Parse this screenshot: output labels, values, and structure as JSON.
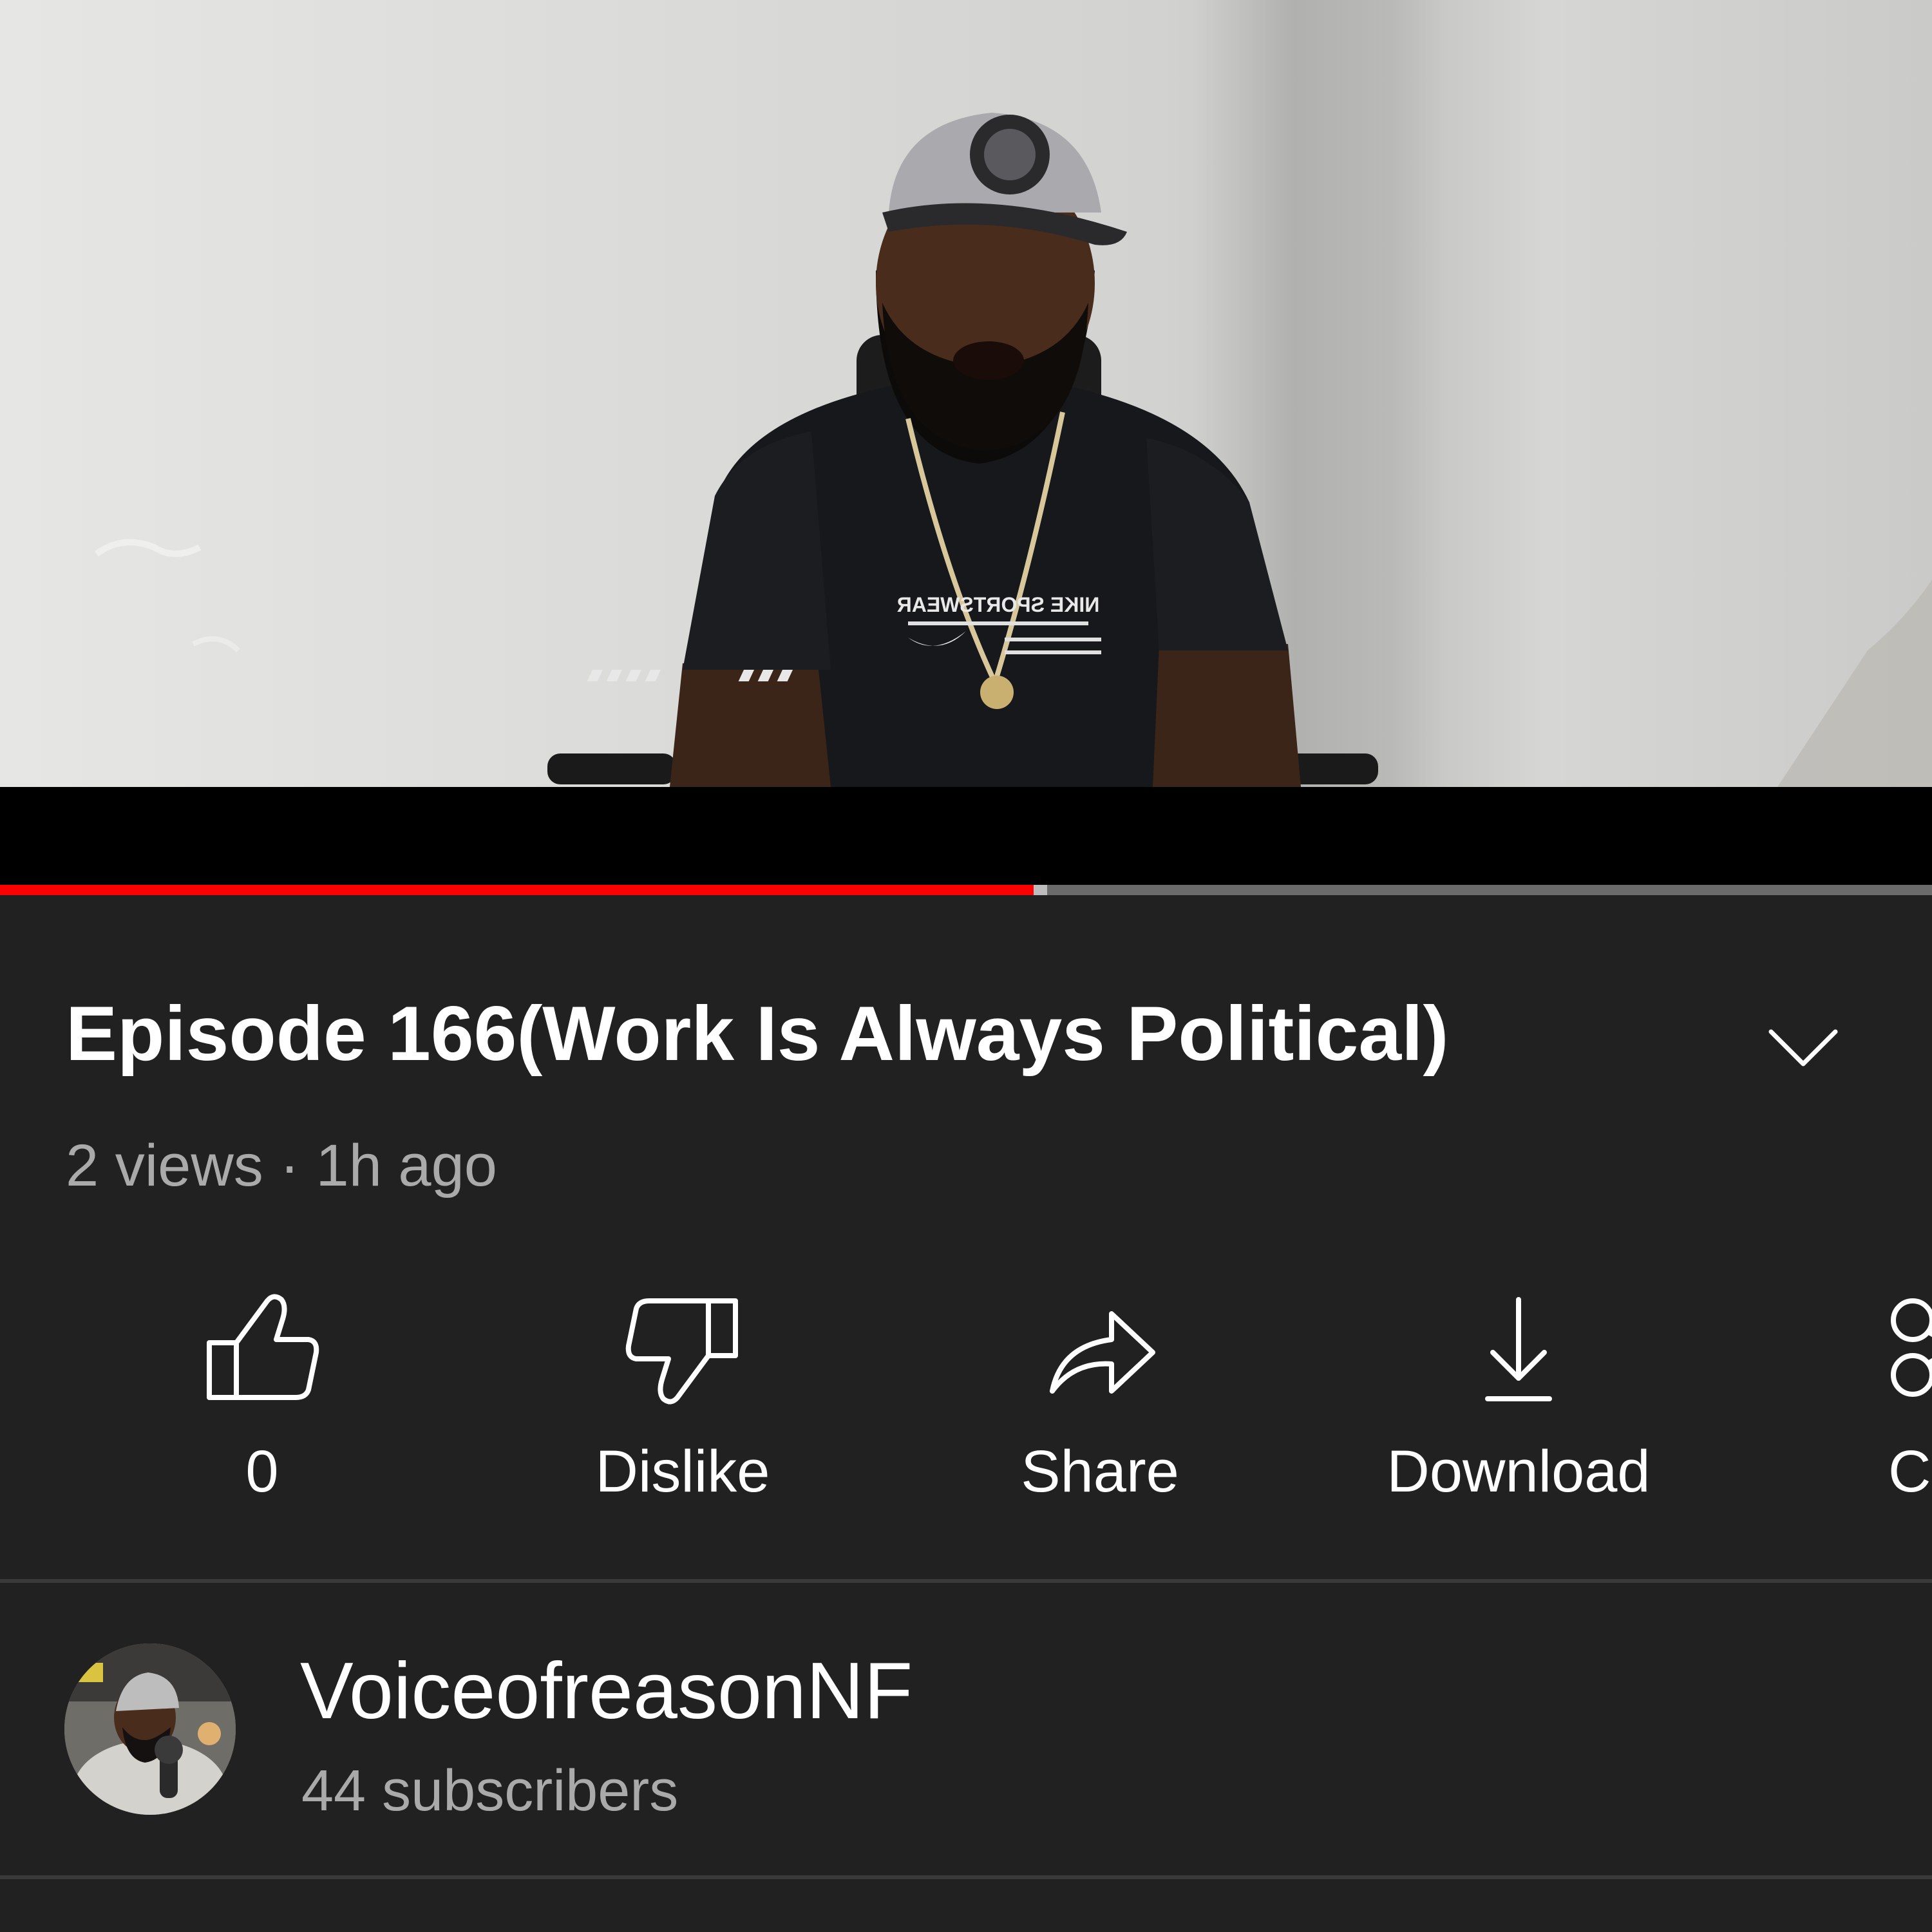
{
  "video": {
    "progress_fraction": 0.535,
    "buffered_fraction": 0.542,
    "progress_color": "#ff0000",
    "track_color": "#6b6b6b",
    "shirt_text": "NIKE SPORTSWEAR"
  },
  "title": "Episode 166(Work Is Always Political)",
  "meta": "2 views · 1h ago",
  "expand_icon": "chevron-down-icon",
  "actions": [
    {
      "name": "like",
      "icon": "thumbs-up-icon",
      "label": "0"
    },
    {
      "name": "dislike",
      "icon": "thumbs-down-icon",
      "label": "Dislike"
    },
    {
      "name": "share",
      "icon": "share-arrow-icon",
      "label": "Share"
    },
    {
      "name": "download",
      "icon": "download-icon",
      "label": "Download"
    },
    {
      "name": "clip",
      "icon": "scissors-icon",
      "label": "Cl"
    }
  ],
  "channel": {
    "name": "VoiceofreasonNF",
    "subscribers": "44 subscribers"
  },
  "colors": {
    "background": "#212121",
    "text_primary": "#ffffff",
    "text_secondary": "#aaaaaa",
    "divider": "#3a3a3a"
  }
}
